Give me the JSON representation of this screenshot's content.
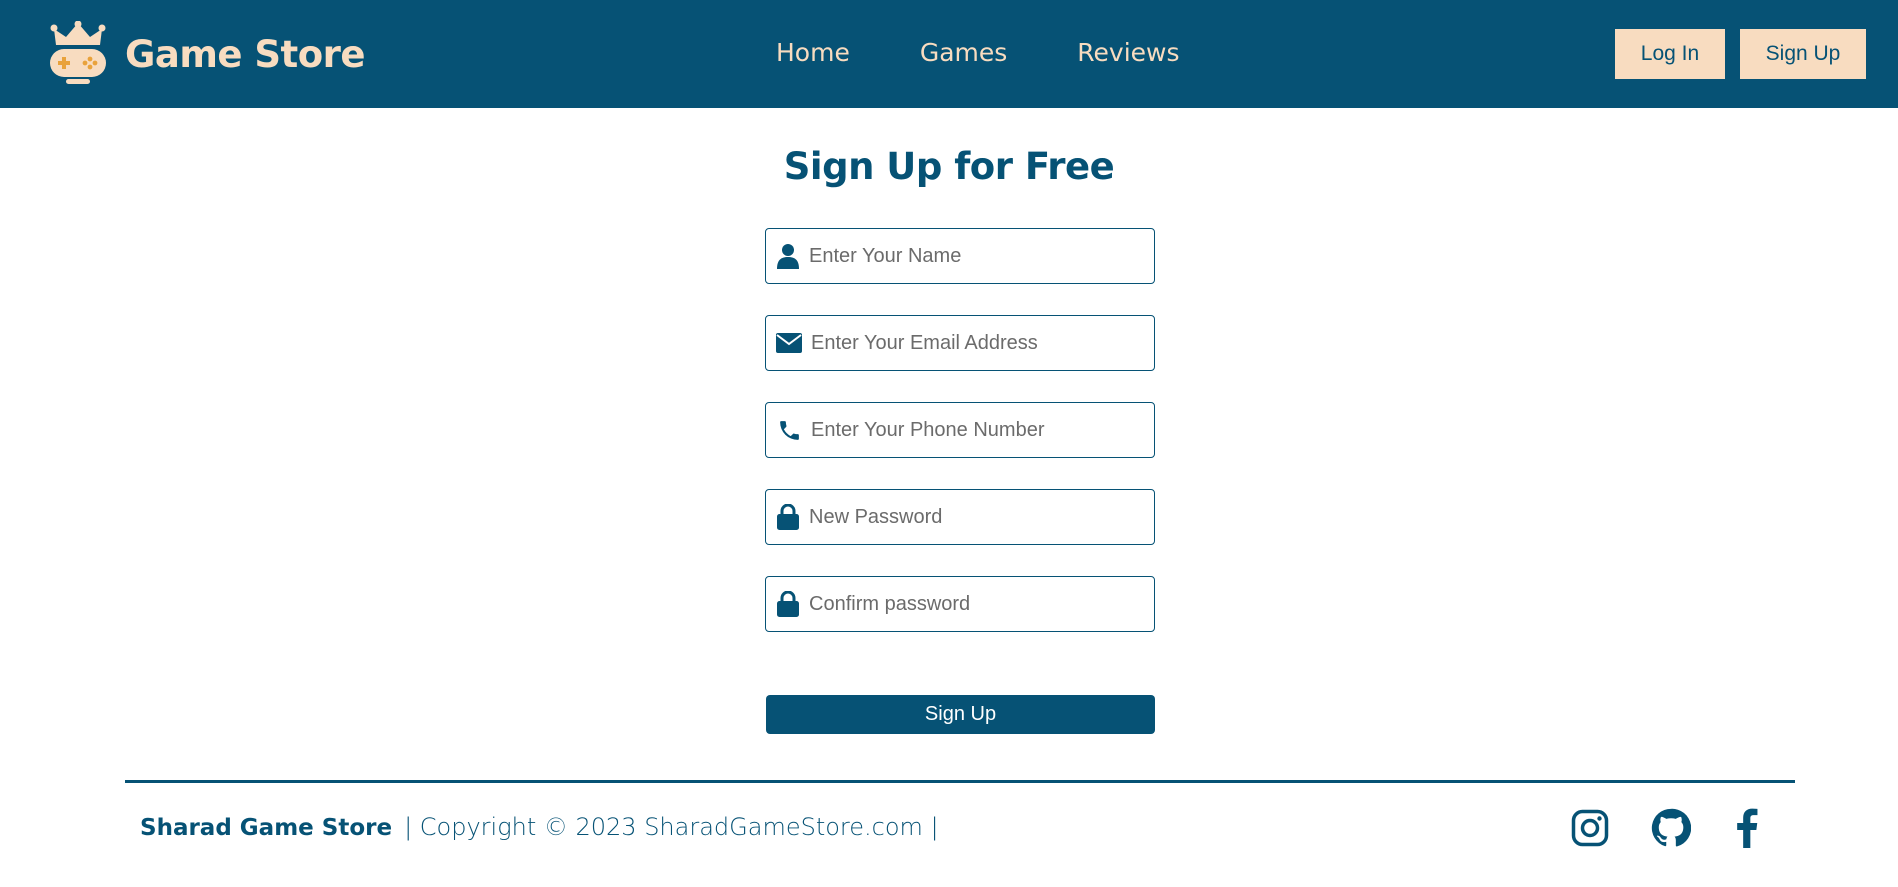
{
  "header": {
    "brand_title": "Game Store",
    "nav": [
      {
        "label": "Home"
      },
      {
        "label": "Games"
      },
      {
        "label": "Reviews"
      }
    ],
    "login_label": "Log In",
    "signup_label": "Sign Up"
  },
  "form": {
    "title": "Sign Up for Free",
    "fields": [
      {
        "icon": "user-icon",
        "placeholder": "Enter Your Name",
        "value": ""
      },
      {
        "icon": "envelope-icon",
        "placeholder": "Enter Your Email Address",
        "value": ""
      },
      {
        "icon": "phone-icon",
        "placeholder": "Enter Your Phone Number",
        "value": ""
      },
      {
        "icon": "lock-icon",
        "placeholder": "New Password",
        "value": ""
      },
      {
        "icon": "lock-icon",
        "placeholder": "Confirm password",
        "value": ""
      }
    ],
    "submit_label": "Sign Up"
  },
  "footer": {
    "brand": "Sharad Game Store",
    "copyright": "| Copyright © 2023 SharadGameStore.com |",
    "social": [
      "instagram-icon",
      "github-icon",
      "facebook-icon"
    ]
  },
  "colors": {
    "primary": "#065275",
    "accent": "#f8dcc0",
    "logo_buttons": "#e9a23b"
  }
}
